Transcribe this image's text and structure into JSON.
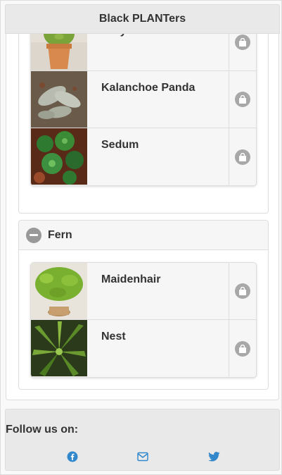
{
  "header": {
    "title": "Black PLANTers"
  },
  "colors": {
    "link_blue": "#3388cc",
    "icon_gray": "#a8a8a8",
    "header_bg": "#e9e9e9"
  },
  "sections": [
    {
      "title": "",
      "items": [
        {
          "name": "Jelly Beans",
          "thumb_icon": "jelly-beans-photo"
        },
        {
          "name": "Kalanchoe Panda",
          "thumb_icon": "kalanchoe-panda-photo"
        },
        {
          "name": "Sedum",
          "thumb_icon": "sedum-photo"
        }
      ]
    },
    {
      "title": "Fern",
      "items": [
        {
          "name": "Maidenhair",
          "thumb_icon": "maidenhair-photo"
        },
        {
          "name": "Nest",
          "thumb_icon": "nest-photo"
        }
      ]
    }
  ],
  "footer": {
    "follow_label": "Follow us on:",
    "social": [
      "facebook-icon",
      "mail-icon",
      "twitter-icon"
    ]
  }
}
